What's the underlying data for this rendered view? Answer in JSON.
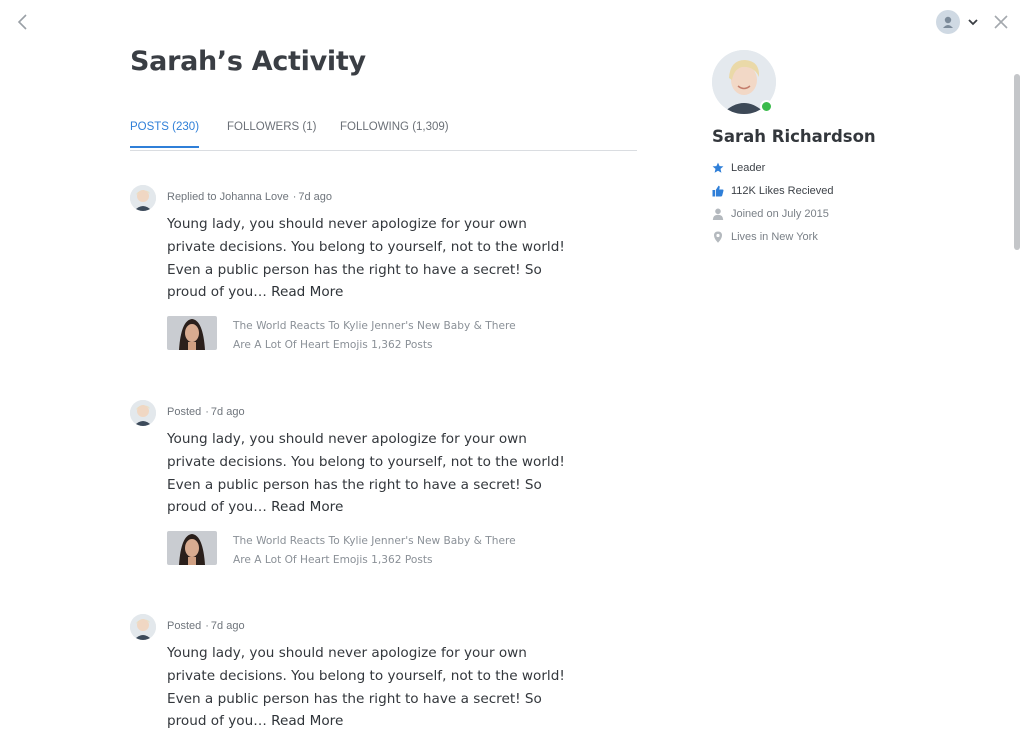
{
  "page": {
    "title": "Sarah’s Activity"
  },
  "tabs": [
    {
      "label": "POSTS (230)",
      "active": true
    },
    {
      "label": "FOLLOWERS (1)",
      "active": false
    },
    {
      "label": "FOLLOWING (1,309)",
      "active": false
    }
  ],
  "posts": [
    {
      "action": "Replied to Johanna Love",
      "time": "7d ago",
      "text": "Young lady, you should never apologize for your own private decisions. You belong to yourself, not to the world! Even a public person has the right to have a secret! So proud of you…",
      "read_more": "Read More",
      "link": {
        "title": "The World Reacts To Kylie Jenner's New Baby & There Are A Lot Of Heart Emojis",
        "count": "1,362 Posts"
      }
    },
    {
      "action": "Posted",
      "time": "7d ago",
      "text": "Young lady, you should never apologize for your own private decisions. You belong to yourself, not to the world! Even a public person has the right to have a secret! So proud of you…",
      "read_more": "Read More",
      "link": {
        "title": "The World Reacts To Kylie Jenner's New Baby & There Are A Lot Of Heart Emojis",
        "count": "1,362 Posts"
      }
    },
    {
      "action": "Posted",
      "time": "7d ago",
      "text": "Young lady, you should never apologize for your own private decisions. You belong to yourself, not to the world! Even a public person has the right to have a secret! So proud of you…",
      "read_more": "Read More"
    }
  ],
  "profile": {
    "name": "Sarah Richardson",
    "online": true,
    "info": [
      {
        "icon": "star-icon",
        "text": "Leader"
      },
      {
        "icon": "thumbs-up-icon",
        "text": "112K Likes Recieved"
      },
      {
        "icon": "person-icon",
        "text": "Joined on July 2015"
      },
      {
        "icon": "location-pin-icon",
        "text": "Lives in New York"
      }
    ]
  },
  "colors": {
    "accent": "#2f7fd8",
    "online": "#3bbb4c",
    "text": "#33373c",
    "muted": "#7a8087"
  }
}
